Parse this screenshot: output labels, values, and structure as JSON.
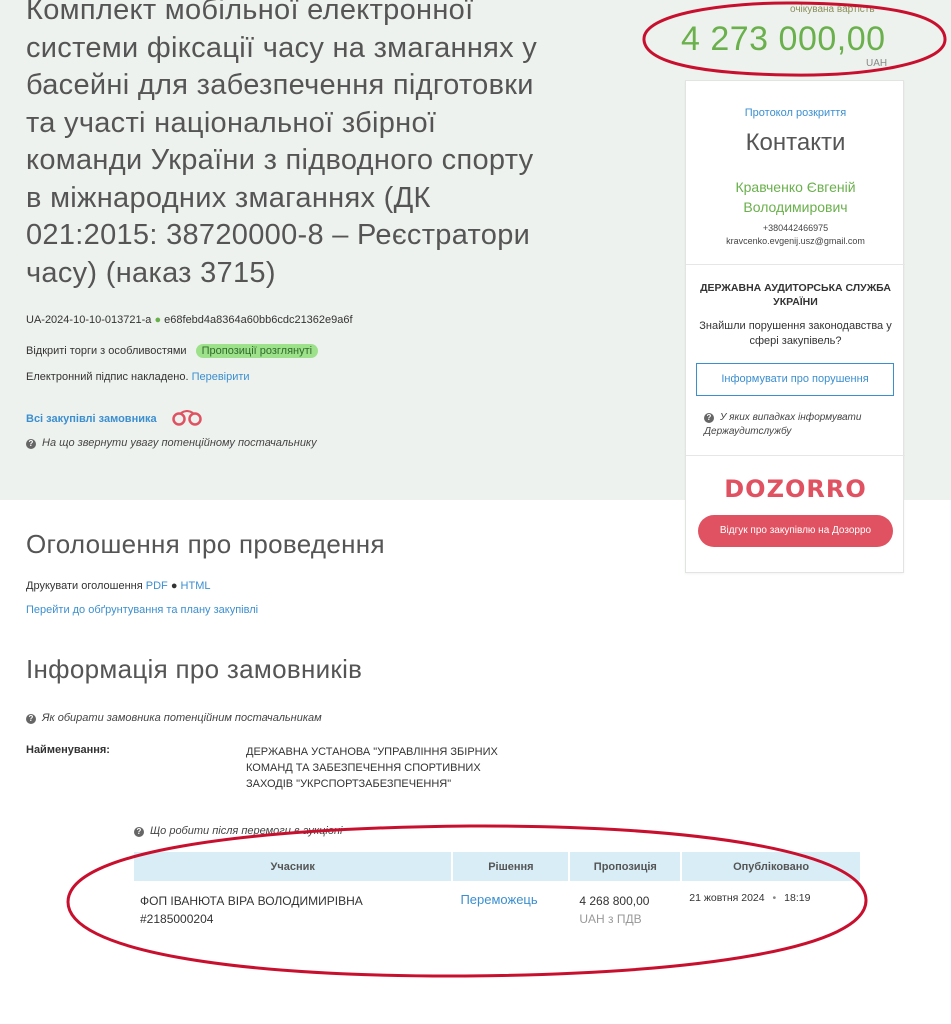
{
  "tender": {
    "title": "Комплект мобільної електронної системи фіксації часу на змаганнях у басейні для забезпечення підготовки та участі національної збірної команди України з підводного спорту в міжнародних змаганнях (ДК 021:2015: 38720000-8 – Реєстратори часу) (наказ 3715)",
    "id": "UA-2024-10-10-013721-a",
    "hash": "e68febd4a8364a60bb6cdc21362e9a6f",
    "procedure": "Відкриті торги з особливостями",
    "status_badge": "Пропозиції розглянуті",
    "signature_text": "Електронний підпис накладено.",
    "signature_link": "Перевірити",
    "all_purchases_link": "Всі закупівлі замовника",
    "supplier_hint": "На що звернути увагу потенційному постачальнику"
  },
  "price": {
    "label": "очікувана вартість",
    "amount": "4 273 000,00",
    "currency": "UAH"
  },
  "sidebar": {
    "protocol_link": "Протокол розкриття",
    "contacts_heading": "Контакти",
    "contact_name": "Кравченко Євгеній Володимирович",
    "phone": "+380442466975",
    "email": "kravcenko.evgenij.usz@gmail.com",
    "auditor_title": "ДЕРЖАВНА АУДИТОРСЬКА СЛУЖБА УКРАЇНИ",
    "auditor_question": "Знайшли порушення законодавства у сфері закупівель?",
    "inform_button": "Інформувати про порушення",
    "inform_hint": "У яких випадках інформувати Держаудитслужбу",
    "dozorro_logo": "DOZORRO",
    "dozorro_button": "Відгук про закупівлю на Дозорро"
  },
  "announcement": {
    "heading": "Оголошення про проведення",
    "print_label": "Друкувати оголошення",
    "pdf_link": "PDF",
    "html_link": "HTML",
    "plan_link": "Перейти до обґрунтування та плану закупівлі"
  },
  "customers": {
    "heading": "Інформація про замовників",
    "hint": "Як обирати замовника потенційним постачальникам",
    "name_label": "Найменування:",
    "name_value": "ДЕРЖАВНА УСТАНОВА \"УПРАВЛІННЯ ЗБІРНИХ КОМАНД ТА ЗАБЕЗПЕЧЕННЯ СПОРТИВНИХ ЗАХОДІВ \"УКРСПОРТЗАБЕЗПЕЧЕННЯ\""
  },
  "bids": {
    "hint": "Що робити після перемоги в аукціоні",
    "headers": [
      "Учасник",
      "Рішення",
      "Пропозиція",
      "Опубліковано"
    ],
    "rows": [
      {
        "participant": "ФОП ІВАНЮТА ВІРА ВОЛОДИМИРІВНА",
        "participant_id": "#2185000204",
        "decision": "Переможець",
        "amount": "4 268 800,00",
        "amount_note": "UAH з ПДВ",
        "date": "21 жовтня 2024",
        "time": "18:19"
      }
    ]
  },
  "colors": {
    "accent_green": "#6ab04c",
    "link_blue": "#3b8fd0",
    "dozorro_red": "#e05261",
    "annotation_red": "#c8102e"
  }
}
